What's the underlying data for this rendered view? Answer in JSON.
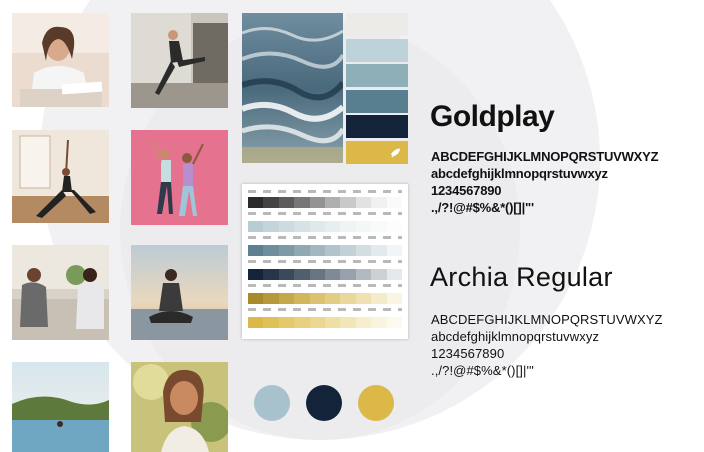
{
  "colors": {
    "light_blue": "#a7c2cc",
    "navy": "#13243a",
    "gold": "#dcb848",
    "swatch_column": [
      "#ecebe7",
      "#bed2da",
      "#8eaeb8",
      "#587f8f",
      "#13243a",
      "#dcb848"
    ]
  },
  "palette_circles": [
    "#a7c2cc",
    "#13243a",
    "#dcb848"
  ],
  "palette_sheet_rows": [
    [
      "#2b2b2b",
      "#434343",
      "#5c5c5c",
      "#777777",
      "#939393",
      "#afafaf",
      "#c9c9c9",
      "#e2e2e2",
      "#f1f1f1",
      "#fafafa"
    ],
    [
      "#b7ccd3",
      "#c3d5db",
      "#ccdbe0",
      "#d6e2e6",
      "#dfe8eb",
      "#e7eef0",
      "#eef3f4",
      "#f4f7f8",
      "#f8fafb",
      "#fcfdfd"
    ],
    [
      "#5f8090",
      "#6f8d9b",
      "#7f9aa7",
      "#90a8b3",
      "#a1b6bf",
      "#b2c3cb",
      "#c3d1d7",
      "#d3dee3",
      "#e3eaee",
      "#f1f5f6"
    ],
    [
      "#13243a",
      "#263648",
      "#3a4a5a",
      "#505f6e",
      "#677482",
      "#7f8a96",
      "#98a1ab",
      "#b2b9c0",
      "#ccd1d6",
      "#e5e8eb"
    ],
    [
      "#a88a2c",
      "#b6993a",
      "#c4a84a",
      "#d2b65c",
      "#dcc170",
      "#e3cc85",
      "#e9d79b",
      "#efe1b2",
      "#f4ebc9",
      "#faf5e3"
    ],
    [
      "#dcb848",
      "#e0c059",
      "#e4c86b",
      "#e8d07e",
      "#ebd791",
      "#efdfa5",
      "#f2e6b8",
      "#f6eecc",
      "#f9f4de",
      "#fcfaef"
    ]
  ],
  "typography": {
    "font1": {
      "name": "Goldplay",
      "uppercase": "ABCDEFGHIJKLMNOPQRSTUVWXYZ",
      "lowercase": "abcdefghijklmnopqrstuvwxyz",
      "digits": "1234567890",
      "symbols": ".,/?!@#$%&*()[]|\"'"
    },
    "font2": {
      "name": "Archia Regular",
      "uppercase": "ABCDEFGHIJKLMNOPQRSTUVWXYZ",
      "lowercase": "abcdefghijklmnopqrstuvwxyz",
      "digits": "1234567890",
      "symbols": ".,/?!@#$%&*()[]|'\""
    }
  }
}
